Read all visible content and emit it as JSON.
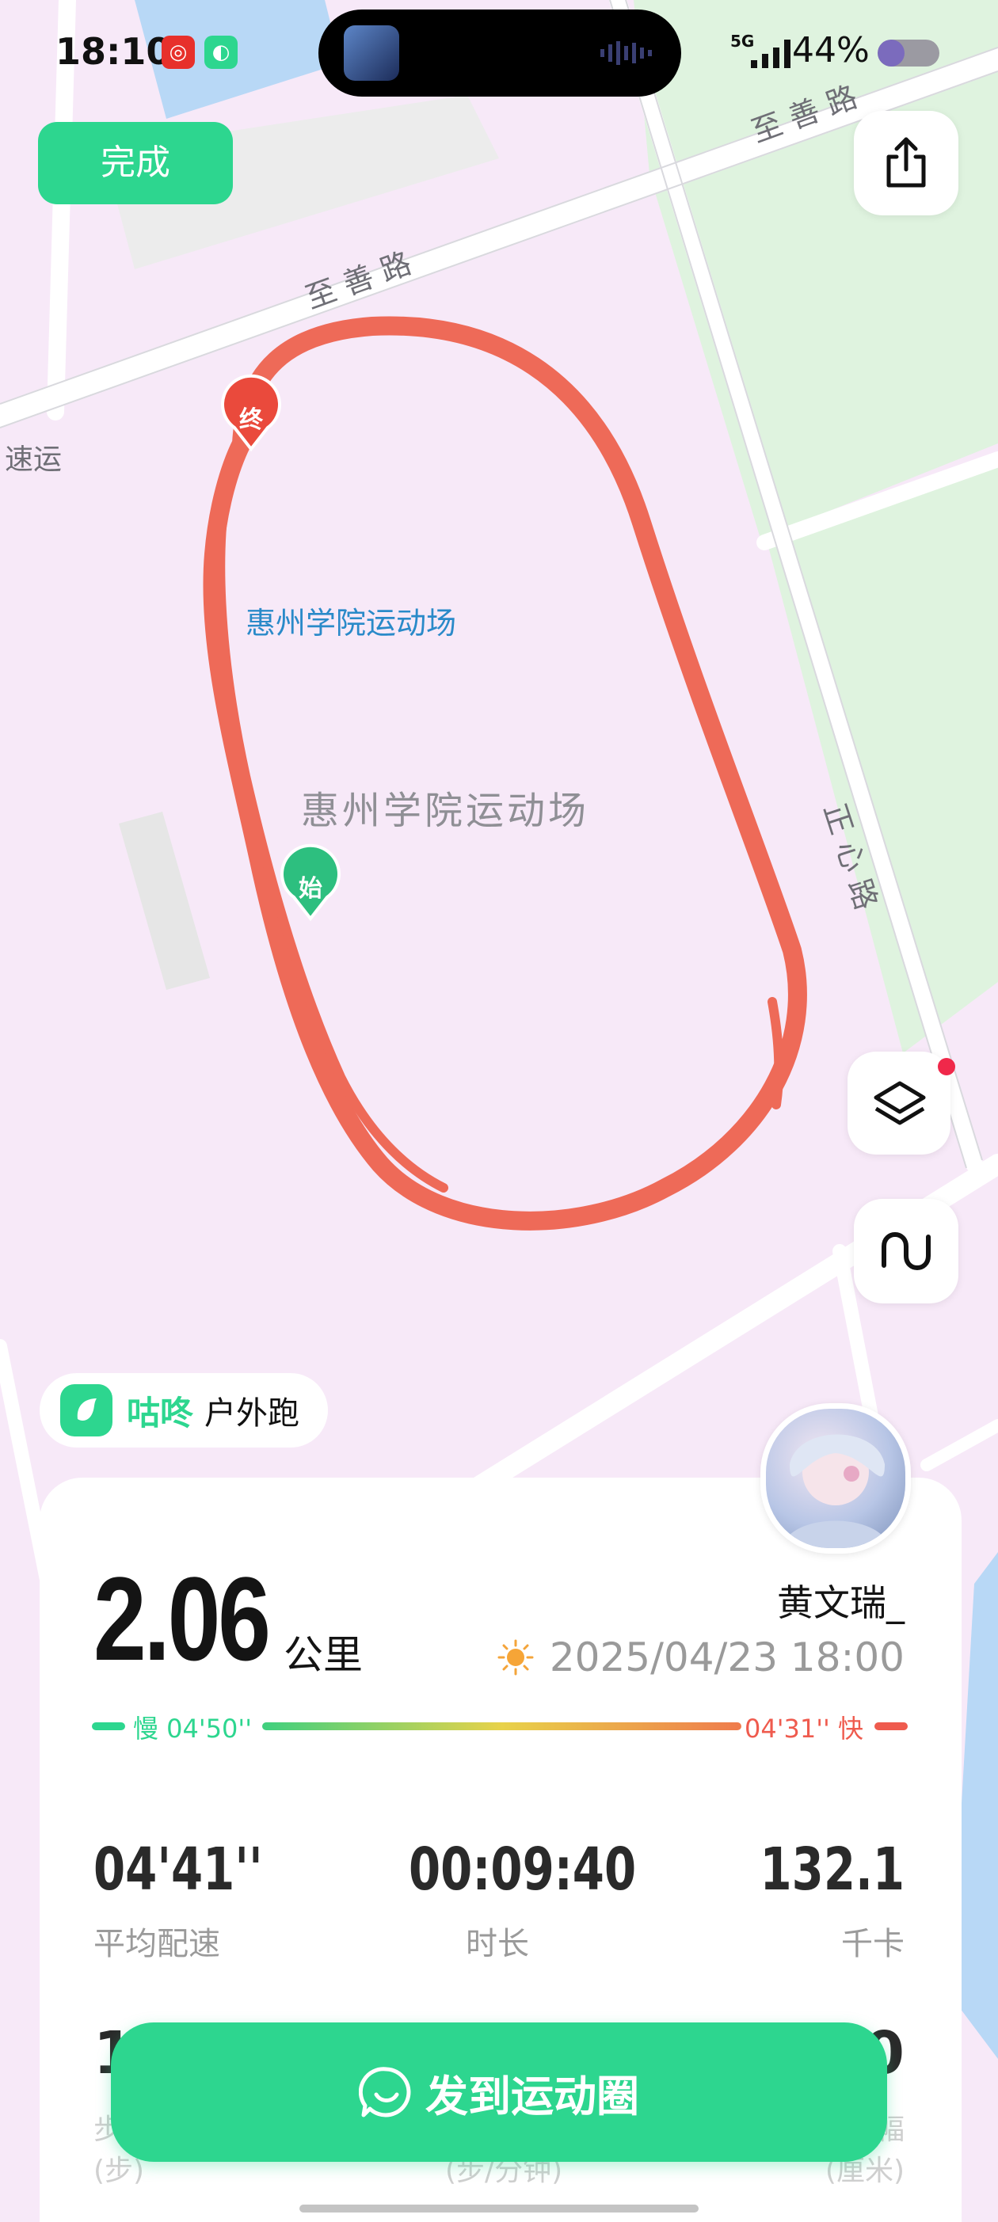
{
  "status_bar": {
    "time": "18:10",
    "signal": "5G",
    "battery": "44%",
    "battery_level": 0.44
  },
  "actions": {
    "done_label": "完成"
  },
  "map": {
    "roads": {
      "zhishan_top": "至 善 路",
      "zhishan_mid": "至 善 路",
      "zhengxin": "正 心 路",
      "suyun": "速运"
    },
    "poi_label": "惠州学院运动场",
    "area_label": "惠州学院运动场",
    "end_marker": "终",
    "start_marker": "始"
  },
  "brand": {
    "name": "咕咚",
    "type": "户外跑"
  },
  "workout": {
    "distance": "2.06",
    "distance_unit": "公里",
    "user": "黄文瑞_",
    "datetime": "2025/04/23 18:00",
    "pace_slow": "慢 04'50''",
    "pace_fast": "04'31'' 快"
  },
  "stats": [
    {
      "value": "04'41''",
      "label": "平均配速"
    },
    {
      "value": "00:09:40",
      "label": "时长"
    },
    {
      "value": "132.1",
      "label": "千卡"
    }
  ],
  "stats2": {
    "left_partial": "1",
    "right_partial": "0",
    "left_label": "步",
    "left_unit": "(步)",
    "mid_unit": "(步/分钟)",
    "right_label": "幅",
    "right_unit": "(厘米)"
  },
  "cta": {
    "label": "发到运动圈"
  },
  "colors": {
    "accent": "#2dd68f",
    "route": "#ee6a58",
    "fast": "#ef5b4e"
  }
}
